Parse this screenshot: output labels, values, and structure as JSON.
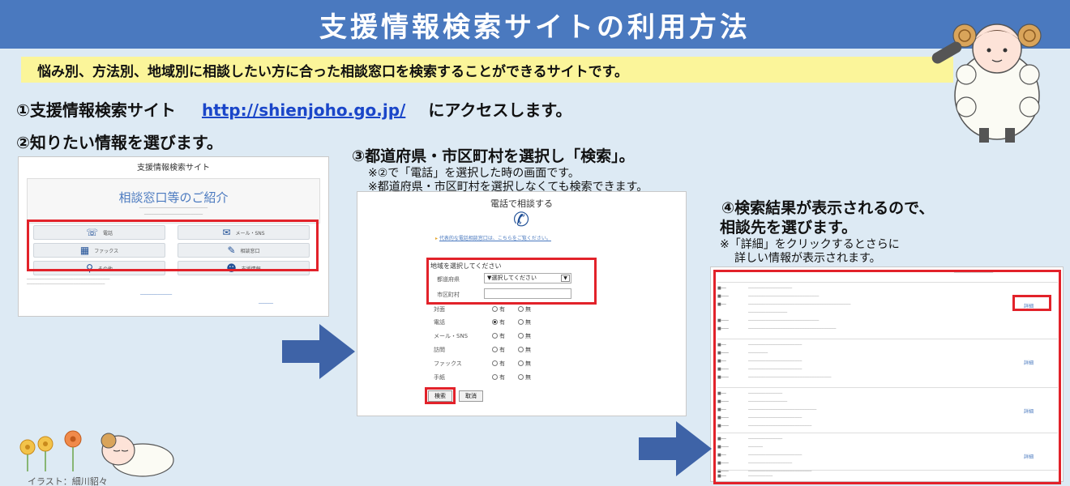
{
  "title": "支援情報検索サイトの利用方法",
  "intro": "悩み別、方法別、地域別に相談したい方に合った相談窓口を検索することができるサイトです。",
  "steps": {
    "step1_prefix": "①支援情報検索サイト",
    "step1_url": "http://shienjoho.go.jp/",
    "step1_suffix": "にアクセスします。",
    "step2": "②知りたい情報を選びます。",
    "step3": "③都道府県・市区町村を選択し「検索」。",
    "step3_note1": "※②で「電話」を選択した時の画面です。",
    "step3_note2": "※都道府県・市区町村を選択しなくても検索できます。",
    "step4_line1": "④検索結果が表示されるので、",
    "step4_line2": "相談先を選びます。",
    "step4_note1": "※「詳細」をクリックするとさらに",
    "step4_note2": "詳しい情報が表示されます。"
  },
  "panel1": {
    "site_title": "支援情報検索サイト",
    "heading": "相談窓口等のご紹介",
    "buttons": [
      {
        "label": "電話",
        "icon": "phone-icon",
        "glyph": "☏"
      },
      {
        "label": "メール・SNS",
        "icon": "mail-icon",
        "glyph": "✉"
      },
      {
        "label": "ファックス",
        "icon": "fax-icon",
        "glyph": "▦"
      },
      {
        "label": "相談窓口",
        "icon": "edit-icon",
        "glyph": "✎"
      },
      {
        "label": "その他",
        "icon": "search-icon",
        "glyph": "🔍"
      },
      {
        "label": "支援情報",
        "icon": "people-icon",
        "glyph": "👥"
      }
    ]
  },
  "panel2": {
    "title": "電話で相談する",
    "link": "代表的な電話相談窓口は、こちらをご覧ください。",
    "form_title": "地域を選択してください",
    "pref_label": "都道府県",
    "pref_value": "▼選択してください",
    "city_label": "市区町村",
    "rows": [
      {
        "label": "対面",
        "yes": "有",
        "no": "無",
        "selected": "none"
      },
      {
        "label": "電話",
        "yes": "有",
        "no": "無",
        "selected": "yes"
      },
      {
        "label": "メール・SNS",
        "yes": "有",
        "no": "無",
        "selected": "none"
      },
      {
        "label": "訪問",
        "yes": "有",
        "no": "無",
        "selected": "none"
      },
      {
        "label": "ファックス",
        "yes": "有",
        "no": "無",
        "selected": "none"
      },
      {
        "label": "手紙",
        "yes": "有",
        "no": "無",
        "selected": "none"
      }
    ],
    "search_button": "検索",
    "cancel_button": "取消"
  },
  "panel3": {
    "detail_label": "詳細"
  },
  "credit": "イラスト：細川貂々",
  "colors": {
    "title_bar": "#4a79bf",
    "background": "#ddeaf4",
    "highlight": "#fbf59a",
    "red_box": "#e2222a",
    "arrow": "#3e63a7",
    "link": "#1a46c9"
  }
}
